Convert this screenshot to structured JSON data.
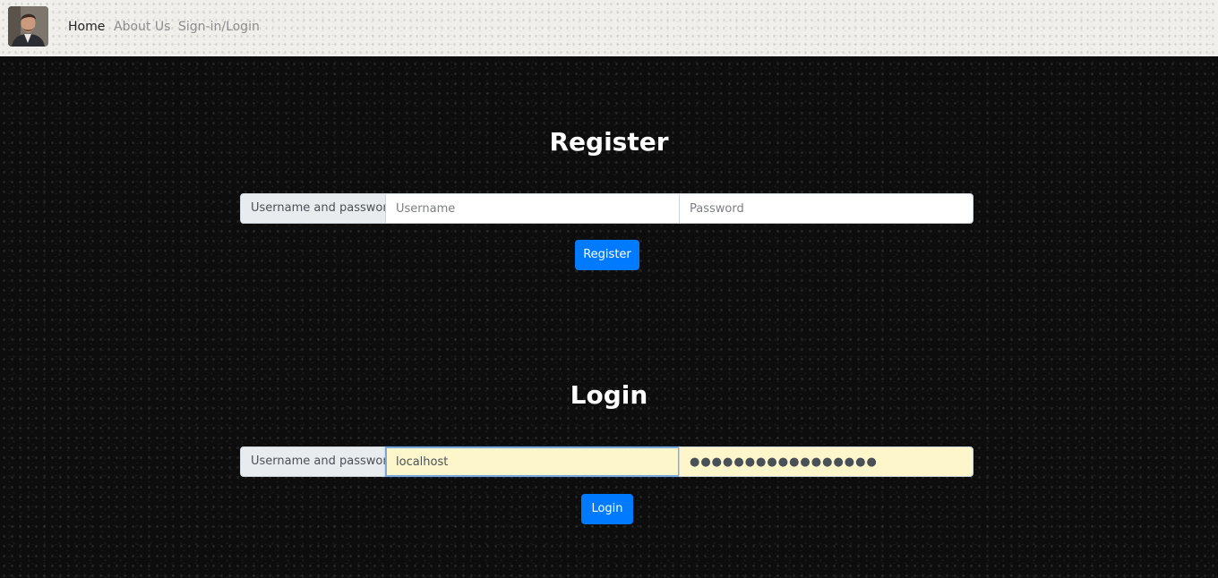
{
  "nav": {
    "items": [
      {
        "label": "Home",
        "active": true
      },
      {
        "label": "About Us",
        "active": false
      },
      {
        "label": "Sign-in/Login",
        "active": false
      }
    ]
  },
  "register": {
    "title": "Register",
    "group_label": "Username and password",
    "username_placeholder": "Username",
    "username_value": "",
    "password_placeholder": "Password",
    "password_value": "",
    "button_label": "Register"
  },
  "login": {
    "title": "Login",
    "group_label": "Username and password",
    "username_value": "localhost",
    "password_value": "●●●●●●●●●●●●●●●●●",
    "button_label": "Login"
  },
  "colors": {
    "accent": "#007bff",
    "autofill": "#fdf6cb",
    "background": "#0d0d0d",
    "navbar": "#f1efec"
  }
}
